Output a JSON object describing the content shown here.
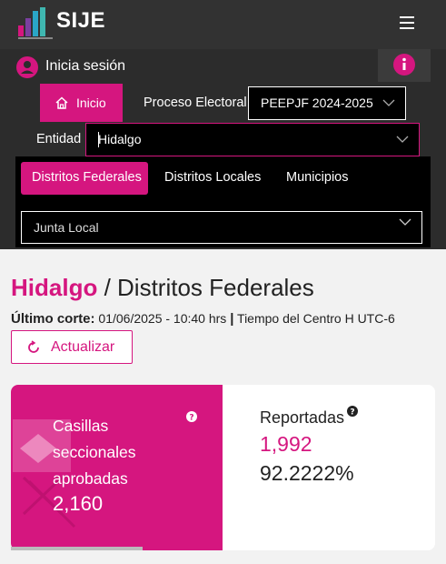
{
  "header": {
    "logo_text": "SIJE",
    "logo_colors": [
      "#d5167f",
      "#7b3fa0",
      "#2aa6c7",
      "#3fb7b0"
    ]
  },
  "nav": {
    "login_label": "Inicia sesión",
    "home_label": "Inicio",
    "proceso_label": "Proceso Electoral",
    "proceso_value": "PEEPJF 2024-2025",
    "entidad_label": "Entidad",
    "entidad_value": "Hidalgo",
    "tabs": [
      {
        "label": "Distritos Federales",
        "active": true
      },
      {
        "label": "Distritos Locales",
        "active": false
      },
      {
        "label": "Municipios",
        "active": false
      }
    ],
    "junta_value": "Junta Local"
  },
  "main": {
    "state": "Hidalgo",
    "section": "/ Distritos Federales",
    "corte_label": "Último corte:",
    "corte_value": "01/06/2025 - 10:40 hrs",
    "separator": "|",
    "timezone": "Tiempo del Centro H UTC-6",
    "refresh_label": "Actualizar"
  },
  "stats": {
    "casillas_label": "Casillas seccionales aprobadas",
    "casillas_value": "2,160",
    "reportadas_label": "Reportadas",
    "reportadas_value": "1,992",
    "reportadas_pct": "92.2222%"
  },
  "colors": {
    "accent": "#d5167f",
    "topbar": "#323232",
    "panel": "#2c2c2c"
  }
}
